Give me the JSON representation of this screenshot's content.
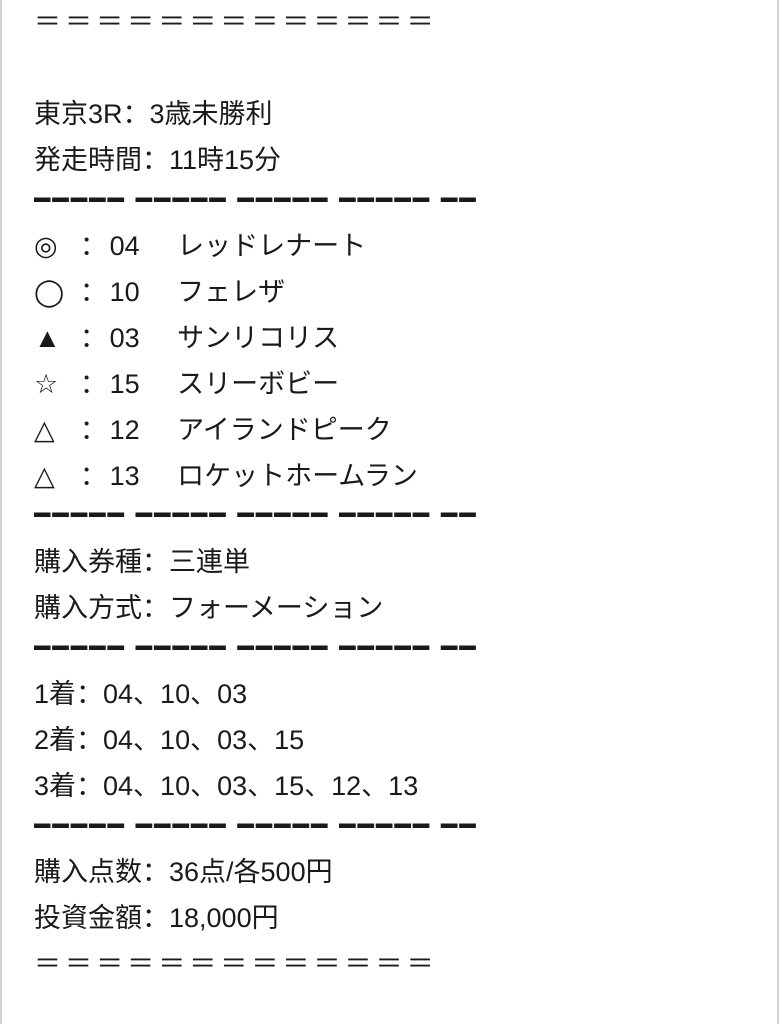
{
  "separator_equals": "＝＝＝＝＝＝＝＝＝＝＝＝＝",
  "separator_dashes": "━━━━━ ━━━━━ ━━━━━ ━━━━━ ━━",
  "race": {
    "header": "東京3R：3歳未勝利",
    "start_time": "発走時間：11時15分"
  },
  "picks": [
    {
      "mark": "◎",
      "num": "04",
      "name": "レッドレナート"
    },
    {
      "mark": "◯",
      "num": "10",
      "name": "フェレザ"
    },
    {
      "mark": "▲",
      "num": "03",
      "name": "サンリコリス"
    },
    {
      "mark": "☆",
      "num": "15",
      "name": "スリーボビー"
    },
    {
      "mark": "△",
      "num": "12",
      "name": "アイランドピーク"
    },
    {
      "mark": "△",
      "num": "13",
      "name": "ロケットホームラン"
    }
  ],
  "purchase": {
    "ticket_type": "購入券種：三連単",
    "method": "購入方式：フォーメーション"
  },
  "placements": {
    "p1": "1着：04、10、03",
    "p2": "2着：04、10、03、15",
    "p3": "3着：04、10、03、15、12、13"
  },
  "summary": {
    "points": "購入点数：36点/各500円",
    "investment": "投資金額：18,000円"
  }
}
